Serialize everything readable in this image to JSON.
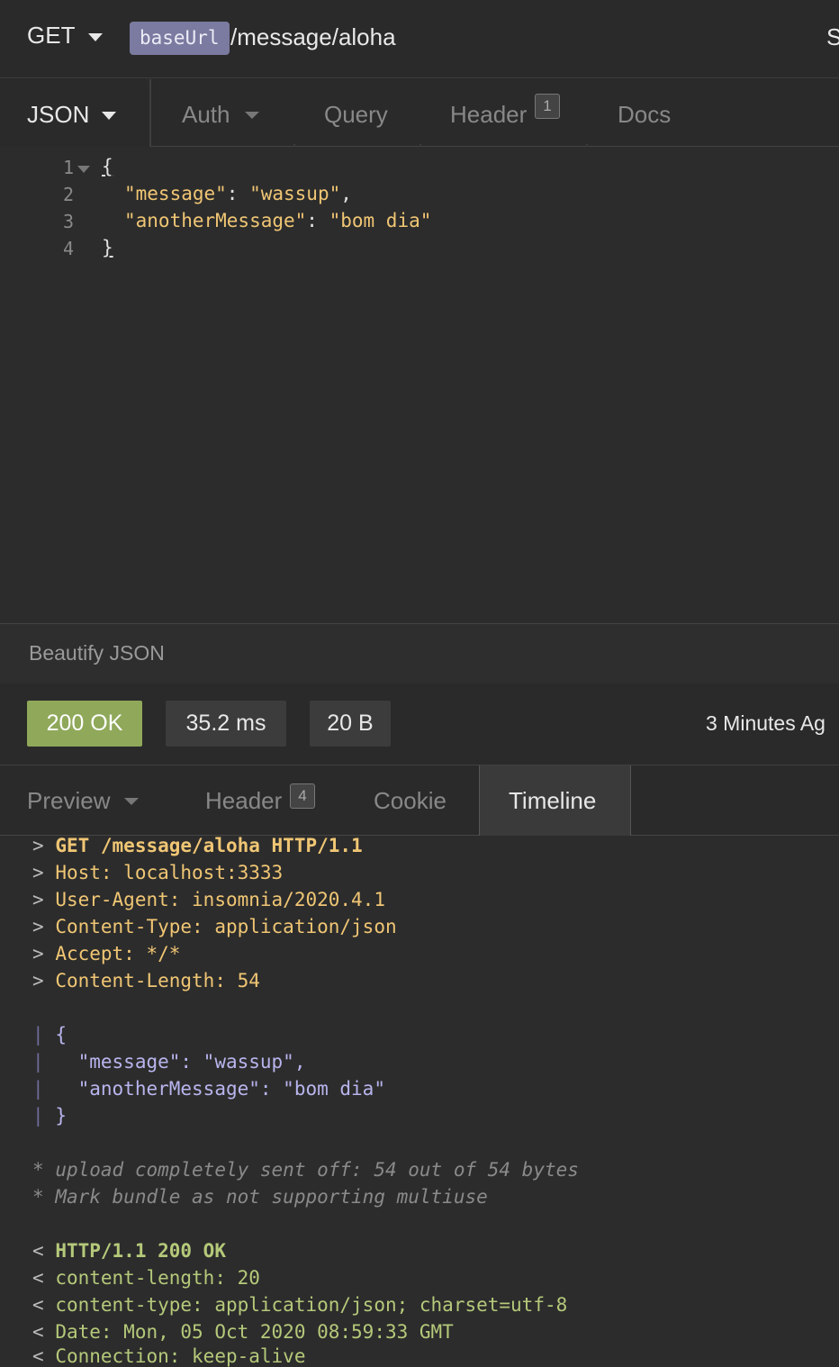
{
  "url_bar": {
    "method": "GET",
    "base_url_tag": "baseUrl",
    "path": "/message/aloha",
    "send_partial": "S"
  },
  "request_tabs": {
    "body": "JSON",
    "auth": "Auth",
    "query": "Query",
    "header": "Header",
    "header_count": "1",
    "docs": "Docs"
  },
  "editor": {
    "line_numbers": [
      "1",
      "2",
      "3",
      "4"
    ],
    "open_brace": "{",
    "line2_key": "\"message\"",
    "line2_value": "\"wassup\"",
    "line3_key": "\"anotherMessage\"",
    "line3_value": "\"bom dia\"",
    "close_brace": "}"
  },
  "beautify": {
    "label": "Beautify JSON"
  },
  "response": {
    "status": "200 OK",
    "status_color": "#8fa85a",
    "time": "35.2 ms",
    "size": "20 B",
    "ago": "3 Minutes Ag"
  },
  "response_tabs": {
    "preview": "Preview",
    "header": "Header",
    "header_count": "4",
    "cookie": "Cookie",
    "timeline": "Timeline"
  },
  "timeline": {
    "request_lines": [
      "GET /message/aloha HTTP/1.1",
      "Host: localhost:3333",
      "User-Agent: insomnia/2020.4.1",
      "Content-Type: application/json",
      "Accept: */*",
      "Content-Length: 54"
    ],
    "body_lines": [
      "{",
      "  \"message\": \"wassup\",",
      "  \"anotherMessage\": \"bom dia\"",
      "}"
    ],
    "info_lines": [
      "upload completely sent off: 54 out of 54 bytes",
      "Mark bundle as not supporting multiuse"
    ],
    "response_lines": [
      "HTTP/1.1 200 OK",
      "content-length: 20",
      "content-type: application/json; charset=utf-8",
      "Date: Mon, 05 Oct 2020 08:59:33 GMT",
      "Connection: keep-alive"
    ],
    "out_prefix": ">",
    "in_prefix": "<",
    "info_prefix": "*",
    "pipe_prefix": "|"
  }
}
